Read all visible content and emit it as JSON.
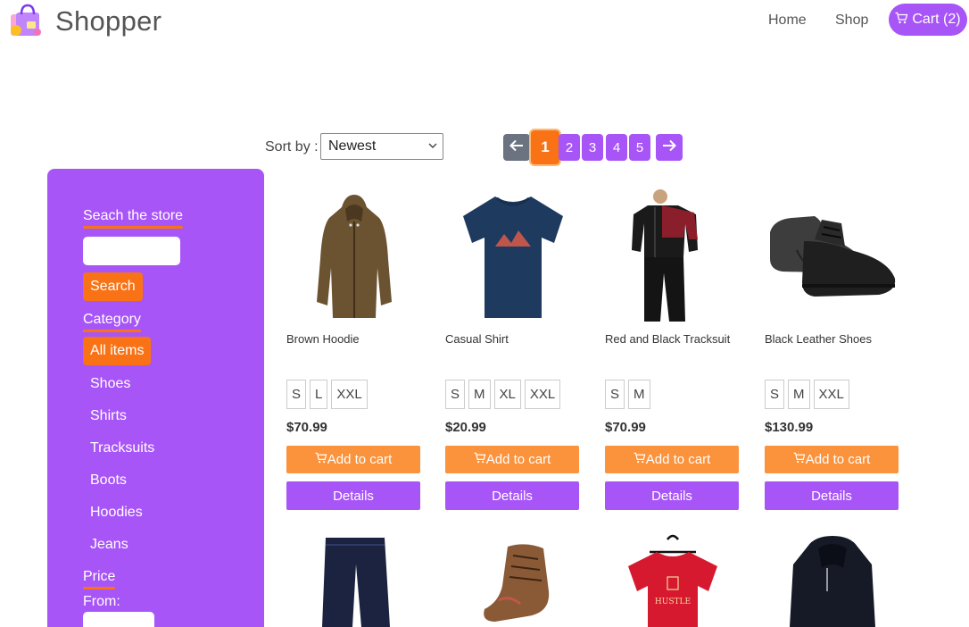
{
  "header": {
    "brand": "Shopper",
    "nav": {
      "home": "Home",
      "shop": "Shop"
    },
    "cart_label": "Cart (2)"
  },
  "toolbar": {
    "sort_label": "Sort by :",
    "sort_value": "Newest"
  },
  "pagination": {
    "prev": "←",
    "pages": [
      "1",
      "2",
      "3",
      "4",
      "5"
    ],
    "next": "→",
    "active_page": "1"
  },
  "sidebar": {
    "search_heading": "Seach the store",
    "search_button": "Search",
    "category_heading": "Category",
    "categories": [
      "All items",
      "Shoes",
      "Shirts",
      "Tracksuits",
      "Boots",
      "Hoodies",
      "Jeans"
    ],
    "active_category": "All items",
    "price_heading": "Price",
    "price_from_label": "From:"
  },
  "products": [
    {
      "name": "Brown Hoodie",
      "sizes": [
        "S",
        "L",
        "XXL"
      ],
      "price": "$70.99",
      "add_label": "Add to cart",
      "details_label": "Details"
    },
    {
      "name": "Casual Shirt",
      "sizes": [
        "S",
        "M",
        "XL",
        "XXL"
      ],
      "price": "$20.99",
      "add_label": "Add to cart",
      "details_label": "Details"
    },
    {
      "name": "Red and Black Tracksuit",
      "sizes": [
        "S",
        "M"
      ],
      "price": "$70.99",
      "add_label": "Add to cart",
      "details_label": "Details"
    },
    {
      "name": "Black Leather Shoes",
      "sizes": [
        "S",
        "M",
        "XXL"
      ],
      "price": "$130.99",
      "add_label": "Add to cart",
      "details_label": "Details"
    }
  ],
  "shirt_print_text": "HUSTLE",
  "colors": {
    "accent": "#a855f7",
    "orange": "#f97316",
    "add_button": "#fb923c",
    "prev_button": "#6b7280"
  }
}
